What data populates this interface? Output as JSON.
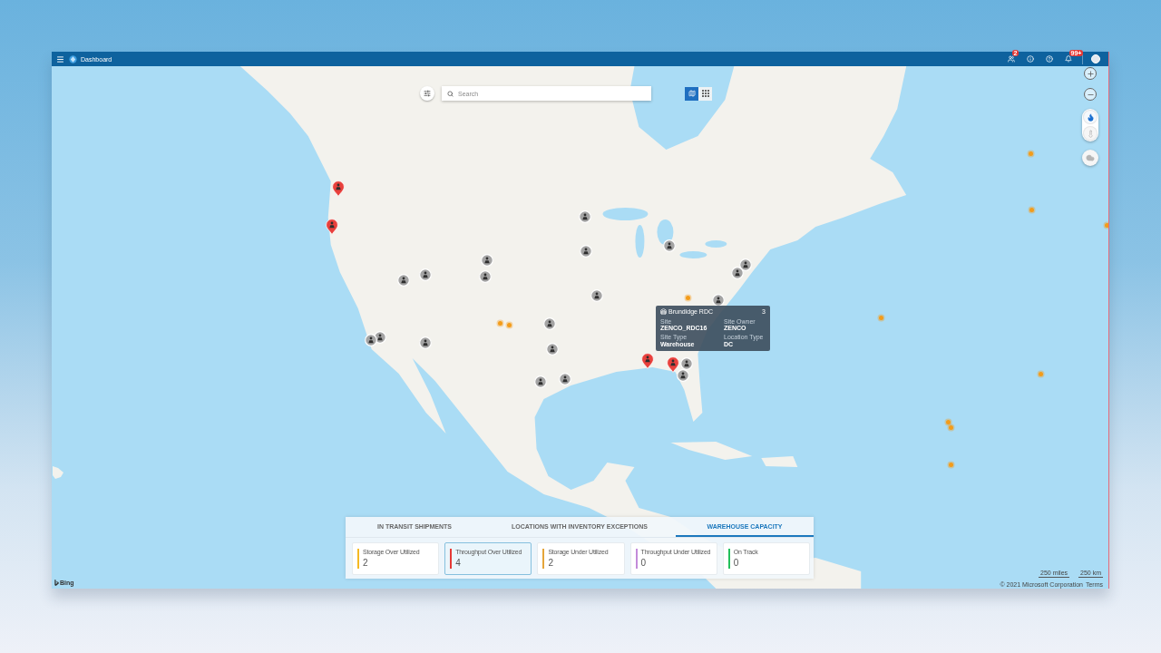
{
  "top_bar": {
    "title": "Dashboard",
    "actions": [
      {
        "kind": "people",
        "badge": "2"
      },
      {
        "kind": "info"
      },
      {
        "kind": "help"
      },
      {
        "kind": "bell",
        "badge": "99+"
      }
    ]
  },
  "search": {
    "placeholder": "Search"
  },
  "view_toggle": [
    {
      "kind": "map",
      "selected": true
    },
    {
      "kind": "grid",
      "selected": false
    }
  ],
  "map_layers": [
    {
      "kind": "flame",
      "selected": true
    },
    {
      "kind": "thermometer",
      "selected": false
    },
    {
      "kind": "cloud",
      "selected": false
    }
  ],
  "markers": [
    {
      "alert": true
    },
    {
      "alert": false
    },
    {
      "alert": true
    },
    {
      "alert": false
    },
    {
      "alert": false
    },
    {
      "alert": false
    },
    {
      "alert": false
    },
    {
      "alert": false
    },
    {
      "alert": false
    },
    {
      "alert": false
    },
    {
      "alert": false
    },
    {
      "alert": false
    },
    {
      "alert": false
    },
    {
      "alert": false
    },
    {
      "alert": false
    },
    {
      "alert": false
    },
    {
      "alert": false
    },
    {
      "alert": false
    },
    {
      "alert": false
    },
    {
      "alert": true
    },
    {
      "alert": true
    },
    {
      "alert": false
    },
    {
      "alert": false
    },
    {
      "alert": false
    }
  ],
  "tooltip": {
    "title": "Brundidge RDC",
    "count": "3",
    "fields": [
      {
        "label": "Site",
        "value": "ZENCO_RDC16"
      },
      {
        "label": "Site Owner",
        "value": "ZENCO"
      },
      {
        "label": "Site Type",
        "value": "Warehouse"
      },
      {
        "label": "Location Type",
        "value": "DC"
      }
    ]
  },
  "panel": {
    "tabs": [
      {
        "label": "IN TRANSIT SHIPMENTS",
        "selected": false
      },
      {
        "label": "LOCATIONS WITH INVENTORY EXCEPTIONS",
        "selected": false
      },
      {
        "label": "WAREHOUSE CAPACITY",
        "selected": true
      }
    ],
    "cards": [
      {
        "label": "Storage Over Utilized",
        "value": "2",
        "color": "#f4b923",
        "selected": false
      },
      {
        "label": "Throughput Over Utilized",
        "value": "4",
        "color": "#e53935",
        "selected": true
      },
      {
        "label": "Storage Under Utilized",
        "value": "2",
        "color": "#e5a53a",
        "selected": false
      },
      {
        "label": "Throughput Under Utilized",
        "value": "0",
        "color": "#c38bd9",
        "selected": false
      },
      {
        "label": "On Track",
        "value": "0",
        "color": "#22c05b",
        "selected": false
      }
    ]
  },
  "attribution": {
    "logo": "Bing",
    "scale": [
      "250 miles",
      "250 km"
    ],
    "copyright": "© 2021 Microsoft Corporation",
    "terms": "Terms"
  }
}
